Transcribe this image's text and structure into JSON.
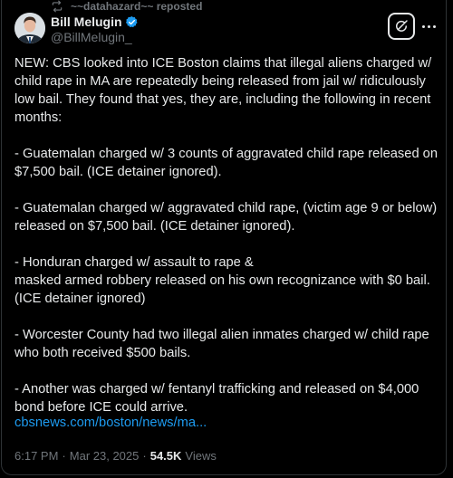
{
  "repost": {
    "icon": "repost-icon",
    "label": "~~datahazard~~ reposted"
  },
  "author": {
    "name": "Bill Melugin",
    "handle": "@BillMelugin_",
    "verified": true
  },
  "post": {
    "paragraphs": [
      "NEW: CBS looked into ICE Boston claims that illegal aliens charged w/ child rape in MA are repeatedly being released from jail w/ ridiculously low bail. They found that yes, they are, including the following in recent months:",
      "- Guatemalan charged w/ 3 counts of aggravated child rape released on $7,500 bail. (ICE detainer ignored).",
      "- Guatemalan charged w/ aggravated child rape, (victim age 9 or below) released on $7,500 bail. (ICE detainer ignored).",
      "- Honduran charged w/ assault to rape &\nmasked armed robbery released on his own recognizance with $0 bail. (ICE detainer ignored)",
      "- Worcester County had two illegal alien inmates charged w/ child rape who both received $500 bails.",
      "- Another was charged w/ fentanyl trafficking and released on $4,000 bond before ICE could arrive."
    ],
    "link": "cbsnews.com/boston/news/ma...",
    "time": "6:17 PM",
    "separator1": "·",
    "date": "Mar 23, 2025",
    "separator2": "·",
    "views_count": "54.5K",
    "views_label": "Views"
  },
  "colors": {
    "background": "#000000",
    "text": "#e7e9ea",
    "muted": "#71767b",
    "link": "#1d9bf0",
    "verified": "#1d9bf0"
  }
}
